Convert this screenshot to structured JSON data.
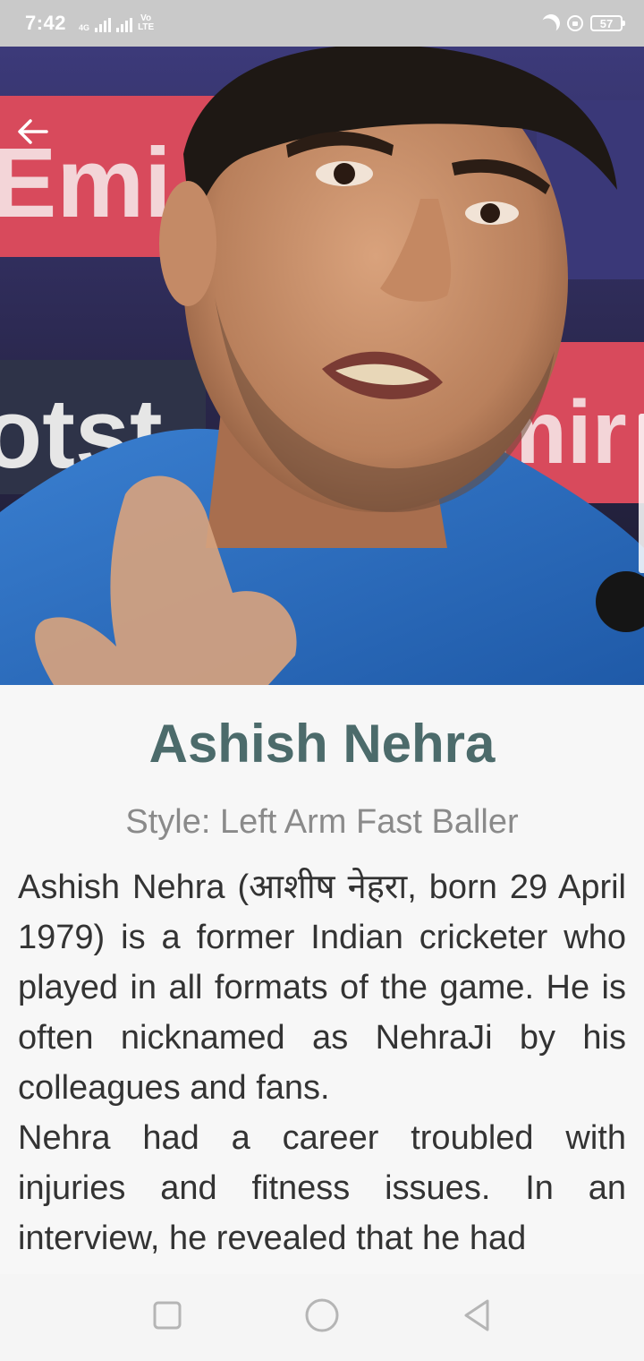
{
  "status_bar": {
    "time": "7:42",
    "network_label": "4G",
    "volte_line1": "Vo",
    "volte_line2": "LTE",
    "battery": "57"
  },
  "header": {
    "back_icon": "arrow-left-icon"
  },
  "hero_image": {
    "alt": "Ashish Nehra photo",
    "banner_text_left_top": "Emi",
    "banner_text_left_bottom": "otst",
    "banner_text_right": "mir"
  },
  "player": {
    "name": "Ashish Nehra",
    "style": "Style: Left Arm Fast Baller",
    "bio_paragraphs": [
      "Ashish Nehra (आशीष नेहरा, born 29 April 1979) is a former Indian cricketer who played in all formats of the game. He is often nicknamed as NehraJi by his colleagues and fans.",
      "Nehra had a career troubled with injuries and fitness issues. In an interview, he revealed that he had"
    ]
  },
  "nav_bar": {
    "recent_icon": "square-icon",
    "home_icon": "circle-icon",
    "back_icon": "triangle-back-icon"
  },
  "colors": {
    "name": "#4c6b6b",
    "style_text": "#8a8a8a",
    "body_text": "#333333",
    "status_bar": "#c9c9c9"
  }
}
